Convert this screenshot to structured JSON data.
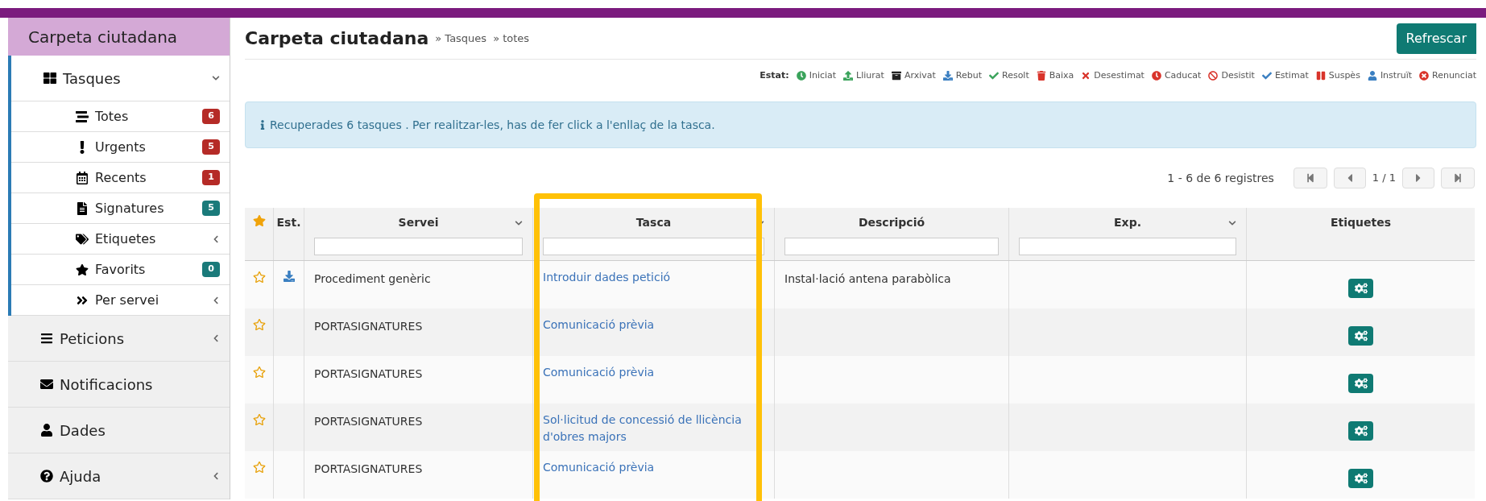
{
  "sidebar": {
    "title": "Carpeta ciutadana",
    "items": [
      {
        "label": "Tasques",
        "expandable": true,
        "expanded": true,
        "children": [
          {
            "label": "Totes",
            "expandable": false,
            "badge": "6",
            "color": "#b52b27"
          },
          {
            "label": "Urgents",
            "expandable": false,
            "badge": "5",
            "color": "#b52b27"
          },
          {
            "label": "Recents",
            "expandable": false,
            "badge": "1",
            "color": "#b52b27"
          },
          {
            "label": "Signatures",
            "expandable": false,
            "badge": "5",
            "color": "#1a7a7a"
          },
          {
            "label": "Etiquetes",
            "expandable": true,
            "expanded": false
          },
          {
            "label": "Favorits",
            "expandable": false,
            "badge": "0",
            "color": "#1a7a7a"
          },
          {
            "label": "Per servei",
            "expandable": true,
            "expanded": false
          }
        ]
      },
      {
        "label": "Peticions",
        "expandable": true,
        "expanded": false
      },
      {
        "label": "Notificacions",
        "expandable": false,
        "expanded": false
      },
      {
        "label": "Dades",
        "expandable": false,
        "expanded": false
      },
      {
        "label": "Ajuda",
        "expandable": true,
        "expanded": false
      }
    ]
  },
  "header": {
    "title": "Carpeta ciutadana",
    "breadcrumbs": [
      "» Tasques",
      "» totes"
    ],
    "refresh_button": "Refrescar"
  },
  "legend": {
    "label": "Estat:",
    "items": [
      {
        "label": "Iniciat",
        "kind": "clock",
        "color": "#3aa35b"
      },
      {
        "label": "Lliurat",
        "kind": "upload",
        "color": "#3aa35b"
      },
      {
        "label": "Arxivat",
        "kind": "archive",
        "color": "#222222"
      },
      {
        "label": "Rebut",
        "kind": "download",
        "color": "#3a7fc1"
      },
      {
        "label": "Resolt",
        "kind": "check",
        "color": "#3aa35b"
      },
      {
        "label": "Baixa",
        "kind": "trash",
        "color": "#d9342b"
      },
      {
        "label": "Desestimat",
        "kind": "times",
        "color": "#d9342b"
      },
      {
        "label": "Caducat",
        "kind": "clock",
        "color": "#d9342b"
      },
      {
        "label": "Desistit",
        "kind": "ban",
        "color": "#d9342b"
      },
      {
        "label": "Estimat",
        "kind": "check",
        "color": "#3a7fc1"
      },
      {
        "label": "Suspès",
        "kind": "pause",
        "color": "#d9342b"
      },
      {
        "label": "Instruït",
        "kind": "user",
        "color": "#3a7fc1"
      },
      {
        "label": "Renunciat",
        "kind": "times-circle",
        "color": "#d9342b"
      }
    ]
  },
  "info": "Recuperades 6 tasques . Per realitzar-les, has de fer click a l'enllaç de la tasca.",
  "pagination": {
    "summary": "1 - 6 de 6 registres",
    "page": "1 / 1"
  },
  "table": {
    "columns": [
      {
        "label": "Est.",
        "sortable": false,
        "filter": false
      },
      {
        "label": "Servei",
        "sortable": true,
        "filter": true
      },
      {
        "label": "Tasca",
        "sortable": true,
        "filter": true
      },
      {
        "label": "Descripció",
        "sortable": false,
        "filter": true
      },
      {
        "label": "Exp.",
        "sortable": true,
        "filter": true
      },
      {
        "label": "Etiquetes",
        "sortable": false,
        "filter": false
      }
    ],
    "rows": [
      {
        "favorite": false,
        "received": true,
        "servei": "Procediment genèric",
        "tasca": "Introduir dades petició",
        "descripcio": "Instal·lació antena parabòlica"
      },
      {
        "favorite": false,
        "received": false,
        "servei": "PORTASIGNATURES",
        "tasca": "Comunicació prèvia",
        "descripcio": ""
      },
      {
        "favorite": false,
        "received": false,
        "servei": "PORTASIGNATURES",
        "tasca": "Comunicació prèvia",
        "descripcio": ""
      },
      {
        "favorite": false,
        "received": false,
        "servei": "PORTASIGNATURES",
        "tasca": "Sol·licitud de concessió de llicència d'obres majors",
        "descripcio": ""
      },
      {
        "favorite": false,
        "received": false,
        "servei": "PORTASIGNATURES",
        "tasca": "Comunicació prèvia",
        "descripcio": ""
      }
    ]
  }
}
